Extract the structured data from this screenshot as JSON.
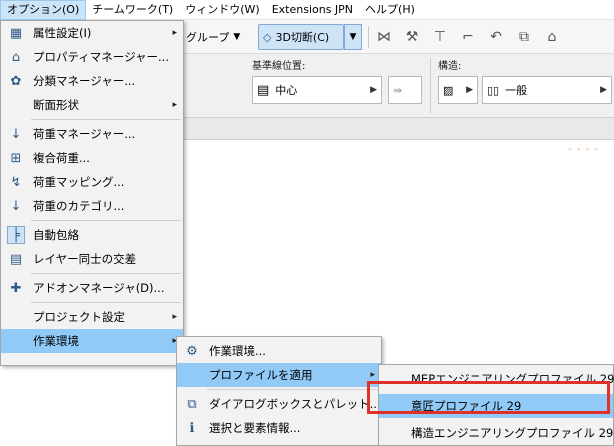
{
  "menubar": [
    "オプション(O)",
    "チームワーク(T)",
    "ウィンドウ(W)",
    "Extensions JPN",
    "ヘルプ(H)"
  ],
  "toolbar": {
    "group_label": "グループ",
    "cut3d_label": "3D切断(C)"
  },
  "infobox": {
    "baseline_label": "基準線位置:",
    "baseline_value": "中心",
    "structure_label": "構造:",
    "structure_value": "一般"
  },
  "options_menu": [
    {
      "label": "属性設定(I)",
      "icon": "attributes-icon",
      "submenu": true
    },
    {
      "label": "プロパティマネージャー...",
      "icon": "tag-icon"
    },
    {
      "label": "分類マネージャー...",
      "icon": "classification-icon"
    },
    {
      "label": "断面形状",
      "icon": "",
      "submenu": true
    },
    {
      "label": "荷重マネージャー...",
      "icon": "load-manager-icon"
    },
    {
      "label": "複合荷重...",
      "icon": "combined-load-icon"
    },
    {
      "label": "荷重マッピング...",
      "icon": "load-mapping-icon"
    },
    {
      "label": "荷重のカテゴリ...",
      "icon": "load-category-icon"
    },
    {
      "label": "自動包絡",
      "icon": "auto-intersection-icon"
    },
    {
      "label": "レイヤー同士の交差",
      "icon": "layer-intersection-icon"
    },
    {
      "label": "アドオンマネージャ(D)...",
      "icon": "addon-icon"
    },
    {
      "label": "プロジェクト設定",
      "icon": "",
      "submenu": true
    },
    {
      "label": "作業環境",
      "icon": "",
      "submenu": true
    }
  ],
  "work_env_menu": [
    {
      "label": "作業環境...",
      "icon": "work-environment-icon"
    },
    {
      "label": "プロファイルを適用",
      "icon": "",
      "submenu": true
    },
    {
      "label": "ダイアログボックスとパレット...",
      "icon": "dialog-palette-icon"
    },
    {
      "label": "選択と要素情報...",
      "icon": "selection-info-icon"
    }
  ],
  "profiles_menu": [
    {
      "label": "MEPエンジニアリングプロファイル 29"
    },
    {
      "label": "意匠プロファイル 29"
    },
    {
      "label": "構造エンジニアリングプロファイル 29"
    }
  ],
  "submenu_arrow": "▸",
  "colors": {
    "highlight": "#91c9f7",
    "callout": "#e0302a"
  }
}
